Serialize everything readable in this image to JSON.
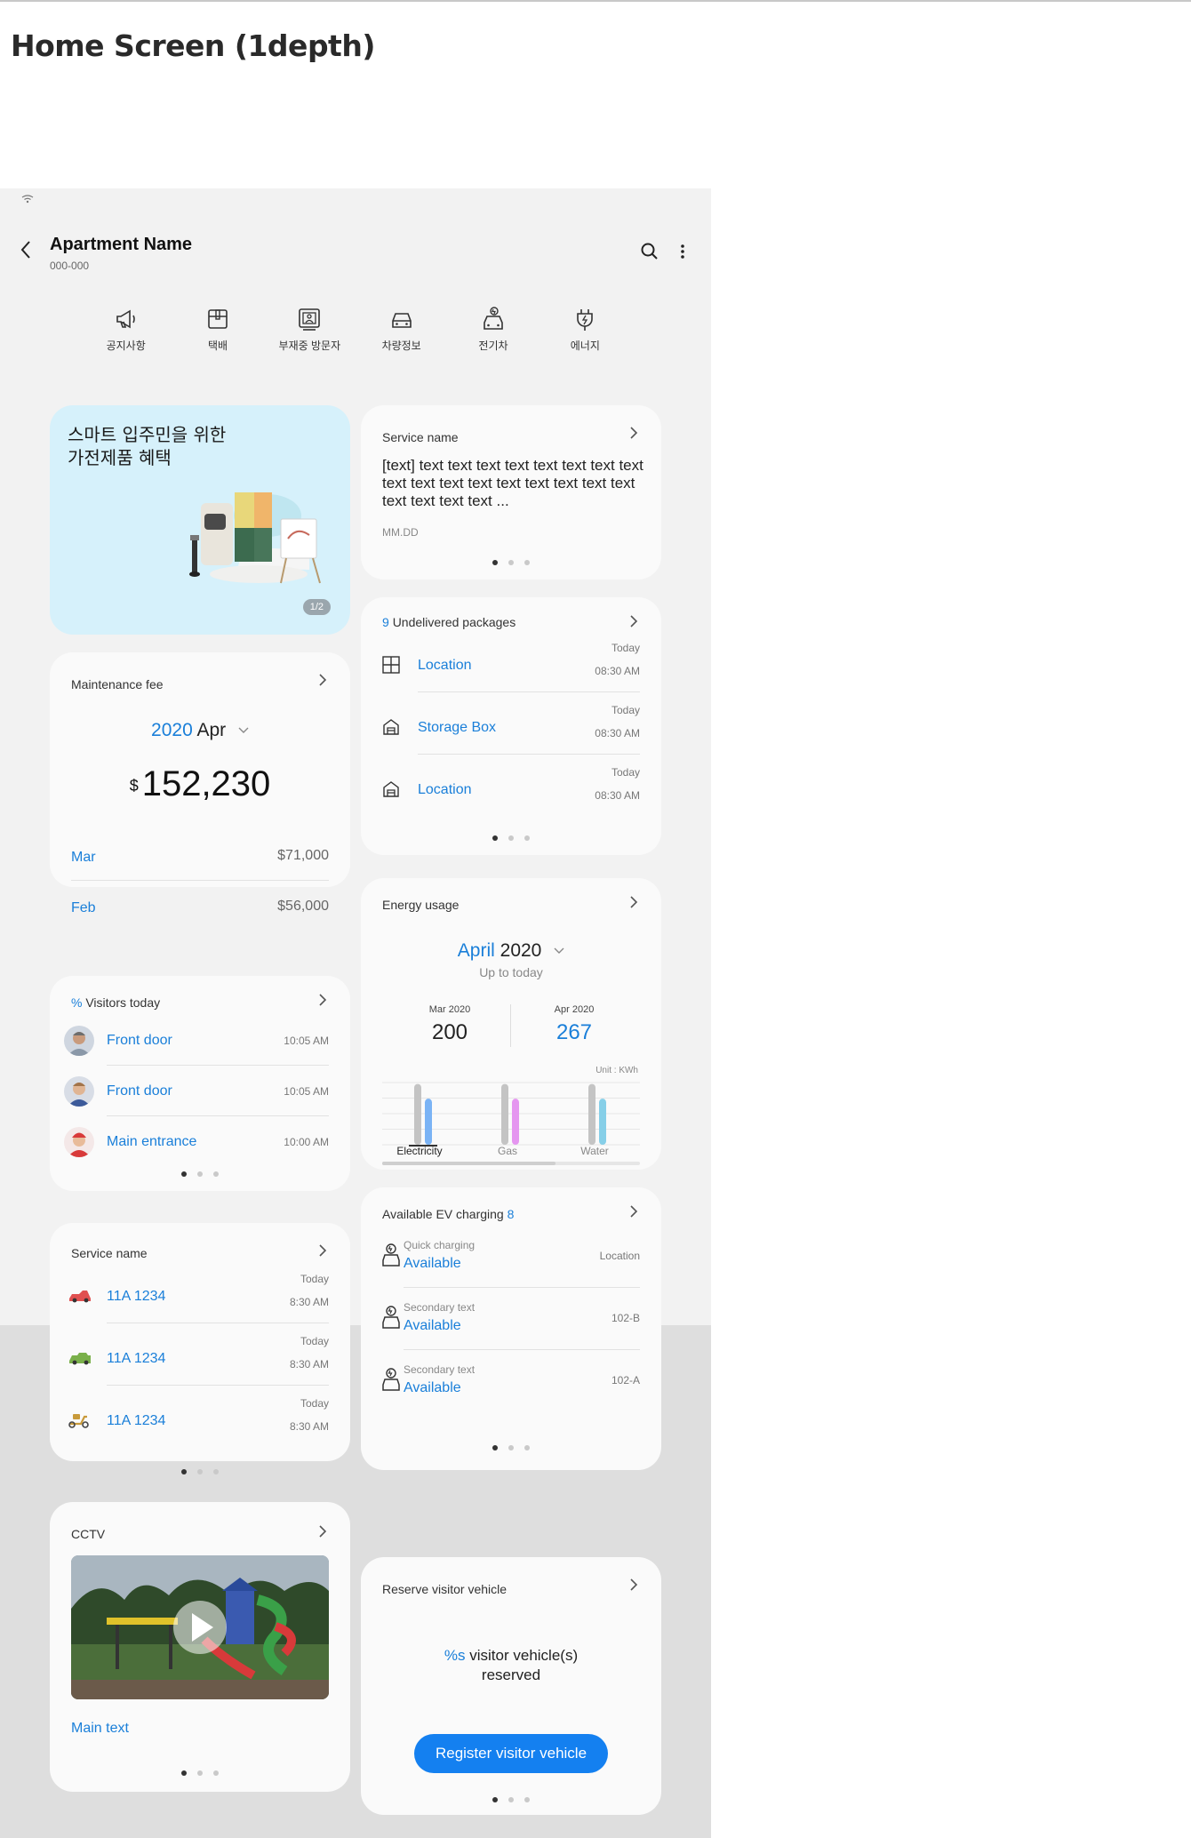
{
  "page": {
    "heading": "Home Screen (1depth)"
  },
  "appbar": {
    "title": "Apartment Name",
    "subtitle": "000-000"
  },
  "shortcuts": [
    {
      "label": "공지사항",
      "icon": "megaphone-icon"
    },
    {
      "label": "택배",
      "icon": "package-icon"
    },
    {
      "label": "부재중 방문자",
      "icon": "visitor-monitor-icon"
    },
    {
      "label": "차량정보",
      "icon": "car-icon"
    },
    {
      "label": "전기차",
      "icon": "ev-car-icon"
    },
    {
      "label": "에너지",
      "icon": "plug-icon"
    }
  ],
  "promo": {
    "line1": "스마트 입주민을 위한",
    "line2": "가전제품 혜택",
    "page": "1/2"
  },
  "notice": {
    "title": "Service name",
    "body": "[text] text text text text text text text text text text text text text text text text text text text text text ...",
    "date": "MM.DD"
  },
  "packages": {
    "count": "9",
    "title": "Undelivered packages",
    "rows": [
      {
        "label": "Location",
        "day": "Today",
        "time": "08:30 AM",
        "icon": "grid-box-icon"
      },
      {
        "label": "Storage Box",
        "day": "Today",
        "time": "08:30 AM",
        "icon": "storage-icon"
      },
      {
        "label": "Location",
        "day": "Today",
        "time": "08:30 AM",
        "icon": "storage-icon"
      }
    ]
  },
  "fee": {
    "title": "Maintenance fee",
    "year": "2020",
    "month": "Apr",
    "currency": "$",
    "amount": "152,230",
    "rows": [
      {
        "label": "Mar",
        "value": "$71,000"
      },
      {
        "label": "Feb",
        "value": "$56,000"
      }
    ]
  },
  "energy": {
    "title": "Energy usage",
    "month": "April",
    "year": "2020",
    "sub": "Up to today",
    "prev_label": "Mar 2020",
    "prev_value": "200",
    "curr_label": "Apr 2020",
    "curr_value": "267",
    "unit": "Unit : KWh",
    "chart_data": {
      "type": "bar",
      "categories": [
        "Electricity",
        "Gas",
        "Water"
      ],
      "series": [
        {
          "name": "Mar 2020",
          "values": [
            95,
            95,
            95
          ],
          "color": "#c4c4c4"
        },
        {
          "name": "Apr 2020",
          "values": [
            72,
            72,
            72
          ],
          "colors": [
            "#7ab3f5",
            "#e596f0",
            "#86cfe8"
          ]
        }
      ],
      "ylim": [
        0,
        100
      ]
    }
  },
  "visitors": {
    "prefix": "%",
    "title": "Visitors today",
    "rows": [
      {
        "label": "Front door",
        "time": "10:05 AM"
      },
      {
        "label": "Front door",
        "time": "10:05 AM"
      },
      {
        "label": "Main entrance",
        "time": "10:00 AM"
      }
    ]
  },
  "vehicles": {
    "title": "Service name",
    "rows": [
      {
        "label": "11A 1234",
        "day": "Today",
        "time": "8:30 AM",
        "icon": "red-car-icon",
        "color": "#e05050"
      },
      {
        "label": "11A 1234",
        "day": "Today",
        "time": "8:30 AM",
        "icon": "green-car-icon",
        "color": "#7ab04a"
      },
      {
        "label": "11A 1234",
        "day": "Today",
        "time": "8:30 AM",
        "icon": "scooter-icon",
        "color": "#c89a3a"
      }
    ]
  },
  "ev": {
    "title": "Available EV charging",
    "count": "8",
    "rows": [
      {
        "secondary": "Quick charging",
        "status": "Available",
        "meta": "Location"
      },
      {
        "secondary": "Secondary text",
        "status": "Available",
        "meta": "102-B"
      },
      {
        "secondary": "Secondary text",
        "status": "Available",
        "meta": "102-A"
      }
    ]
  },
  "cctv": {
    "title": "CCTV",
    "main_text": "Main text"
  },
  "reserve": {
    "title": "Reserve visitor vehicle",
    "count": "%s",
    "line1": "visitor vehicle(s)",
    "line2": "reserved",
    "button": "Register visitor vehicle"
  }
}
